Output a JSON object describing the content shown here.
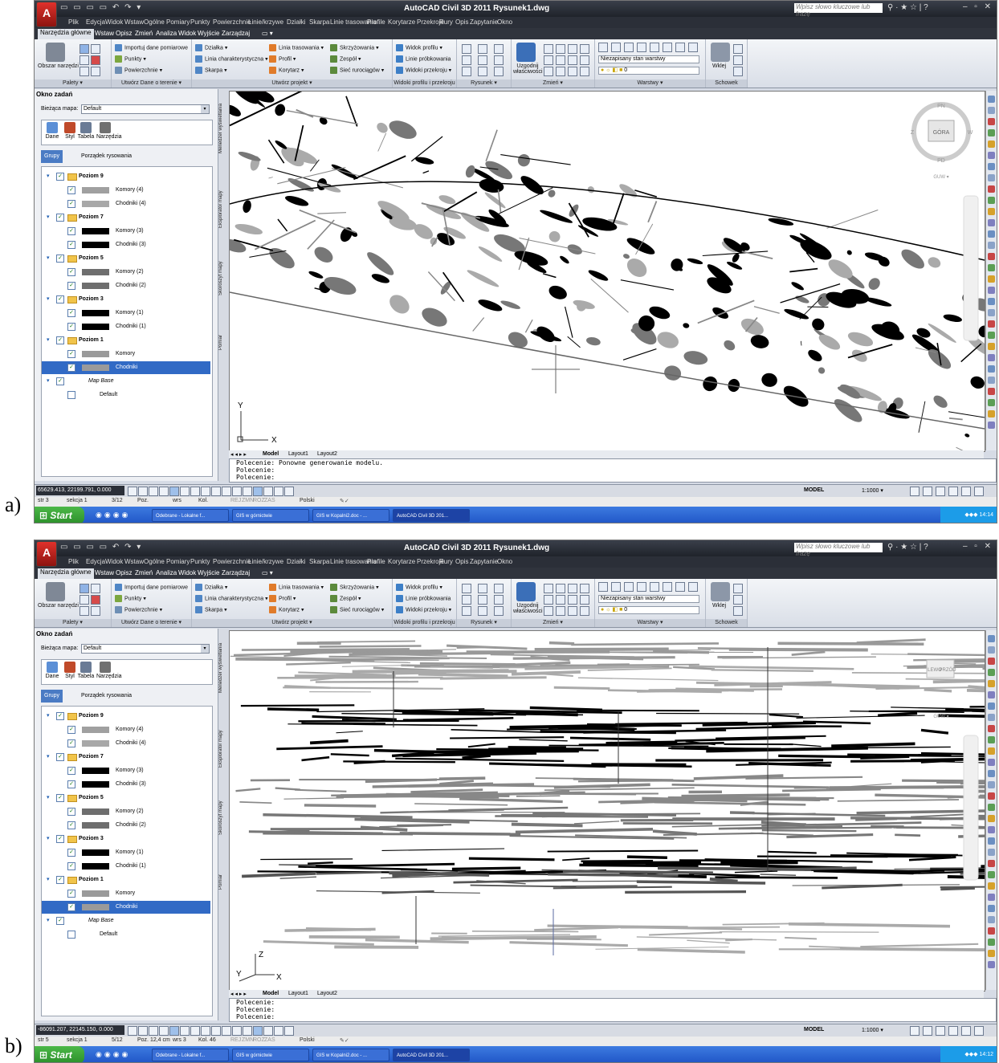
{
  "figure": {
    "panels": [
      {
        "letter": "a)",
        "title": "AutoCAD Civil 3D 2011   Rysunek1.dwg",
        "search_placeholder": "Wpisz słowo kluczowe lub frazę",
        "menu": [
          "Plik",
          "Edycja",
          "Widok",
          "Wstaw",
          "Ogólne",
          "Pomiary",
          "Punkty",
          "Powierzchnie",
          "Linie/krzywe",
          "Działki",
          "Skarpa",
          "Linie trasowania",
          "Profile",
          "Korytarze",
          "Przekroje",
          "Rury",
          "Opis",
          "Zapytanie",
          "Okno"
        ],
        "ribbon_tabs": [
          "Narzędzia główne",
          "Wstaw",
          "Opisz",
          "Zmień",
          "Analiza",
          "Widok",
          "Wyjście",
          "Zarządzaj"
        ],
        "ribbon_groups": {
          "palety": {
            "title": "Palety ▾",
            "big_label": "Obszar narzędzi"
          },
          "dane": {
            "title": "Utwórz Dane o terenie ▾",
            "items": [
              "Importuj dane pomiarowe",
              "Punkty ▾",
              "Powierzchnie ▾"
            ]
          },
          "projekt1": {
            "items": [
              "Działka ▾",
              "Linia charakterystyczna ▾",
              "Skarpa ▾"
            ]
          },
          "projekt2": {
            "title": "Utwórz projekt ▾",
            "items": [
              "Linia trasowania ▾",
              "Profil ▾",
              "Korytarz ▾"
            ]
          },
          "projekt3": {
            "items": [
              "Skrzyżowania ▾",
              "Zespół ▾",
              "Sieć rurociągów ▾"
            ]
          },
          "widoki": {
            "title": "Widoki profilu i przekroju",
            "items": [
              "Widok profilu ▾",
              "Linie próbkowania",
              "Widoki przekroju ▾"
            ]
          },
          "rysunek": {
            "title": "Rysunek ▾"
          },
          "zmien": {
            "title": "Zmień ▾",
            "big_label": "Uzgodnij właściwości"
          },
          "warstwy": {
            "title": "Warstwy ▾",
            "layer_state": "Niezapisany stan warstwy",
            "layer_current": "0"
          },
          "schowek": {
            "title": "Schowek",
            "big_label": "Wklej"
          }
        },
        "taskpane": {
          "title": "Okno zadań",
          "map_label": "Bieżąca mapa:",
          "map_value": "Default",
          "tools": [
            "Dane",
            "Styl",
            "Tabela",
            "Narzędzia"
          ],
          "tabs": [
            "Grupy",
            "Porządek rysowania"
          ],
          "side_tabs": [
            "Menedżer wyświetlania",
            "Eksplorator mapy",
            "Skoroszyt mapy",
            "Pomiar"
          ],
          "tree": [
            {
              "group": "Poziom 9",
              "items": [
                {
                  "name": "Komory (4)",
                  "color": "#a0a0a0"
                },
                {
                  "name": "Chodniki (4)",
                  "color": "#a8a8a8"
                }
              ]
            },
            {
              "group": "Poziom 7",
              "items": [
                {
                  "name": "Komory (3)",
                  "color": "#000000"
                },
                {
                  "name": "Chodniki (3)",
                  "color": "#000000"
                }
              ]
            },
            {
              "group": "Poziom 5",
              "items": [
                {
                  "name": "Komory (2)",
                  "color": "#6e6e6e"
                },
                {
                  "name": "Chodniki (2)",
                  "color": "#6e6e6e"
                }
              ]
            },
            {
              "group": "Poziom 3",
              "items": [
                {
                  "name": "Komory (1)",
                  "color": "#000000"
                },
                {
                  "name": "Chodniki (1)",
                  "color": "#000000"
                }
              ]
            },
            {
              "group": "Poziom 1",
              "items": [
                {
                  "name": "Komory",
                  "color": "#9a9a9a"
                },
                {
                  "name": "Chodniki",
                  "color": "#9a9a9a",
                  "selected": true
                }
              ]
            },
            {
              "group": "Map Base",
              "italic": true,
              "items": [
                {
                  "name": "Default",
                  "color": ""
                }
              ]
            }
          ]
        },
        "navcube": {
          "top": "GÓRA",
          "n": "PN",
          "s": "PD",
          "w": "W",
          "e": "Z",
          "ucs": "GUW ▾"
        },
        "axis_labels": [
          "Y",
          "X"
        ],
        "layout_tabs": [
          "Model",
          "Layout1",
          "Layout2"
        ],
        "command_lines": [
          "Polecenie:  Ponowne generowanie modelu.",
          "Polecenie:",
          "Polecenie:"
        ],
        "coords": "65629.413, 22199.791, 0.000",
        "status_right": [
          "MODEL",
          "1:1000 ▾"
        ],
        "info": [
          "str 3",
          "sekcja 1",
          "3/12",
          "Poz.",
          "wrs",
          "Kol.",
          "REJ",
          "ZMN",
          "ROZ",
          "ZAS",
          "Polski"
        ],
        "taskbar": {
          "start": "Start",
          "buttons": [
            "Odebrane - Lokalne f...",
            "GIS w górnictwie",
            "GIS w Kopalni2.doc - ...",
            "AutoCAD Civil 3D 201..."
          ],
          "time": "14:14"
        }
      },
      {
        "letter": "b)",
        "title": "AutoCAD Civil 3D 2011   Rysunek1.dwg",
        "search_placeholder": "Wpisz słowo kluczowe lub frazę",
        "menu": [
          "Plik",
          "Edycja",
          "Widok",
          "Wstaw",
          "Ogólne",
          "Pomiary",
          "Punkty",
          "Powierzchnie",
          "Linie/krzywe",
          "Działki",
          "Skarpa",
          "Linie trasowania",
          "Profile",
          "Korytarze",
          "Przekroje",
          "Rury",
          "Opis",
          "Zapytanie",
          "Okno"
        ],
        "ribbon_tabs": [
          "Narzędzia główne",
          "Wstaw",
          "Opisz",
          "Zmień",
          "Analiza",
          "Widok",
          "Wyjście",
          "Zarządzaj"
        ],
        "ribbon_groups": {
          "palety": {
            "title": "Palety ▾",
            "big_label": "Obszar narzędzi"
          },
          "dane": {
            "title": "Utwórz Dane o terenie ▾",
            "items": [
              "Importuj dane pomiarowe",
              "Punkty ▾",
              "Powierzchnie ▾"
            ]
          },
          "projekt1": {
            "items": [
              "Działka ▾",
              "Linia charakterystyczna ▾",
              "Skarpa ▾"
            ]
          },
          "projekt2": {
            "title": "Utwórz projekt ▾",
            "items": [
              "Linia trasowania ▾",
              "Profil ▾",
              "Korytarz ▾"
            ]
          },
          "projekt3": {
            "items": [
              "Skrzyżowania ▾",
              "Zespół ▾",
              "Sieć rurociągów ▾"
            ]
          },
          "widoki": {
            "title": "Widoki profilu i przekroju",
            "items": [
              "Widok profilu ▾",
              "Linie próbkowania",
              "Widoki przekroju ▾"
            ]
          },
          "rysunek": {
            "title": "Rysunek ▾"
          },
          "zmien": {
            "title": "Zmień ▾",
            "big_label": "Uzgodnij właściwości"
          },
          "warstwy": {
            "title": "Warstwy ▾",
            "layer_state": "Niezapisany stan warstwy",
            "layer_current": "0"
          },
          "schowek": {
            "title": "Schowek",
            "big_label": "Wklej"
          }
        },
        "taskpane": {
          "title": "Okno zadań",
          "map_label": "Bieżąca mapa:",
          "map_value": "Default",
          "tools": [
            "Dane",
            "Styl",
            "Tabela",
            "Narzędzia"
          ],
          "tabs": [
            "Grupy",
            "Porządek rysowania"
          ],
          "side_tabs": [
            "Menedżer wyświetlania",
            "Eksplorator mapy",
            "Skoroszyt mapy",
            "Pomiar"
          ],
          "tree": [
            {
              "group": "Poziom 9",
              "items": [
                {
                  "name": "Komory (4)",
                  "color": "#a0a0a0"
                },
                {
                  "name": "Chodniki (4)",
                  "color": "#a8a8a8"
                }
              ]
            },
            {
              "group": "Poziom 7",
              "items": [
                {
                  "name": "Komory (3)",
                  "color": "#000000"
                },
                {
                  "name": "Chodniki (3)",
                  "color": "#000000"
                }
              ]
            },
            {
              "group": "Poziom 5",
              "items": [
                {
                  "name": "Komory (2)",
                  "color": "#6e6e6e"
                },
                {
                  "name": "Chodniki (2)",
                  "color": "#6e6e6e"
                }
              ]
            },
            {
              "group": "Poziom 3",
              "items": [
                {
                  "name": "Komory (1)",
                  "color": "#000000"
                },
                {
                  "name": "Chodniki (1)",
                  "color": "#000000"
                }
              ]
            },
            {
              "group": "Poziom 1",
              "items": [
                {
                  "name": "Komory",
                  "color": "#9a9a9a"
                },
                {
                  "name": "Chodniki",
                  "color": "#9a9a9a",
                  "selected": true
                }
              ]
            },
            {
              "group": "Map Base",
              "italic": true,
              "items": [
                {
                  "name": "Default",
                  "color": ""
                }
              ]
            }
          ]
        },
        "navcube": {
          "top": "LEWO",
          "n": "PRZÓD",
          "ucs": "GUW ▾"
        },
        "axis_labels": [
          "Z",
          "Y",
          "X"
        ],
        "layout_tabs": [
          "Model",
          "Layout1",
          "Layout2"
        ],
        "command_lines": [
          "Polecenie:",
          "Polecenie:",
          "Polecenie:"
        ],
        "coords": "-86091.207, 22145.150, 0.000",
        "status_right": [
          "MODEL",
          "1:1000 ▾"
        ],
        "info": [
          "str 5",
          "sekcja 1",
          "5/12",
          "Poz. 12,4 cm",
          "wrs 3",
          "Kol. 46",
          "REJ",
          "ZMN",
          "ROZ",
          "ZAS",
          "Polski"
        ],
        "taskbar": {
          "start": "Start",
          "buttons": [
            "Odebrane - Lokalne f...",
            "GIS w górnictwie",
            "GIS w Kopalni2.doc - ...",
            "AutoCAD Civil 3D 201..."
          ],
          "time": "14:12"
        }
      }
    ]
  }
}
